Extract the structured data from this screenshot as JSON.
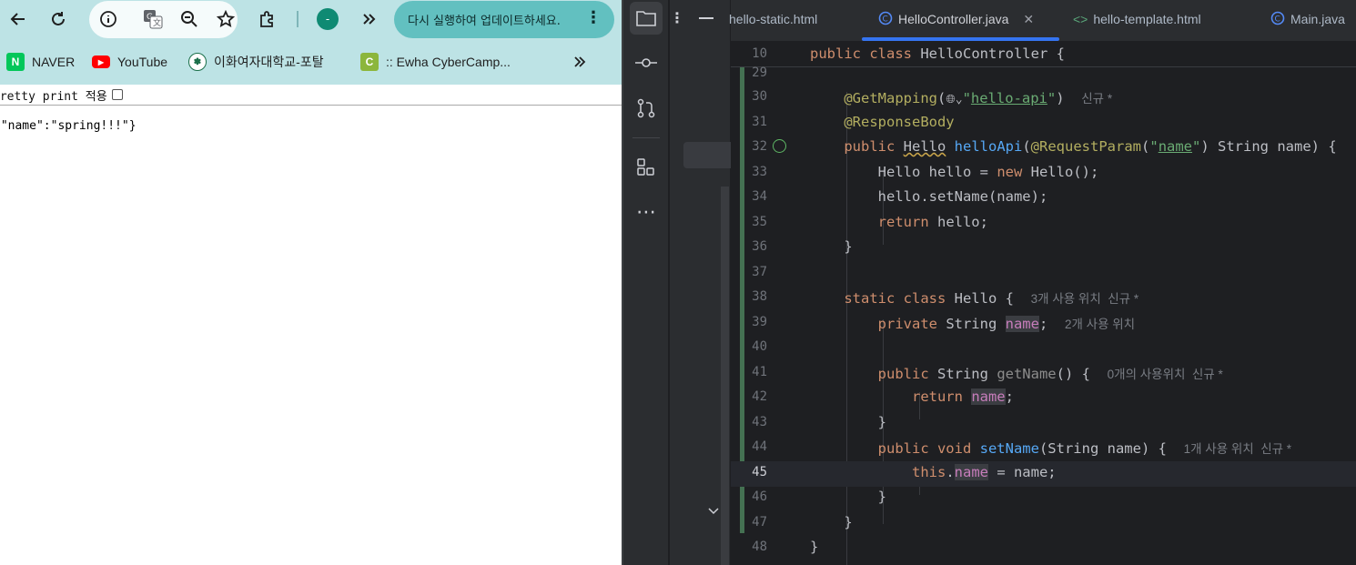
{
  "browser": {
    "toolbar": {
      "back_icon": "arrow-left-icon",
      "reload_icon": "reload-icon",
      "profile_initial": "-",
      "update_label": "다시 실행하여 업데이트하세요."
    },
    "bookmarks": [
      {
        "label": "NAVER",
        "icon": "naver-logo",
        "color": "#03c75a"
      },
      {
        "label": "YouTube",
        "icon": "youtube-logo",
        "color": "#ff0000"
      },
      {
        "label": "이화여자대학교-포탈",
        "icon": "ewha-logo",
        "color": "#1b6f4a"
      },
      {
        "label": ":: Ewha CyberCamp...",
        "icon": "cybercamp-logo",
        "color": "#8cb63c"
      }
    ],
    "page": {
      "pretty_print_label": "Pretty print 적용",
      "json_output": "{\"name\":\"spring!!!\"}"
    }
  },
  "ide": {
    "tabs": [
      {
        "label": "hello-static.html",
        "icon": "html-file-icon"
      },
      {
        "label": "HelloController.java",
        "icon": "java-class-icon",
        "active": true
      },
      {
        "label": "hello-template.html",
        "icon": "html-file-icon"
      },
      {
        "label": "Main.java",
        "icon": "java-class-icon"
      }
    ],
    "sticky_line": {
      "num": "10",
      "code": "public class HelloController {"
    },
    "lines": [
      {
        "num": "29",
        "code": ""
      },
      {
        "num": "30",
        "code": "@GetMapping(\"hello-api\")",
        "hint": "신규 *"
      },
      {
        "num": "31",
        "code": "@ResponseBody"
      },
      {
        "num": "32",
        "code": "public Hello helloApi(@RequestParam(\"name\") String name) {"
      },
      {
        "num": "33",
        "code": "Hello hello = new Hello();"
      },
      {
        "num": "34",
        "code": "hello.setName(name);"
      },
      {
        "num": "35",
        "code": "return hello;"
      },
      {
        "num": "36",
        "code": "}"
      },
      {
        "num": "37",
        "code": ""
      },
      {
        "num": "38",
        "code": "static class Hello {",
        "hint": "3개 사용 위치  신규 *"
      },
      {
        "num": "39",
        "code": "private String name;",
        "hint": "2개 사용 위치"
      },
      {
        "num": "40",
        "code": ""
      },
      {
        "num": "41",
        "code": "public String getName() {",
        "hint": "0개의 사용위치  신규 *"
      },
      {
        "num": "42",
        "code": "return name;"
      },
      {
        "num": "43",
        "code": "}"
      },
      {
        "num": "44",
        "code": "public void setName(String name) {",
        "hint": "1개 사용 위치  신규 *"
      },
      {
        "num": "45",
        "code": "this.name = name;"
      },
      {
        "num": "46",
        "code": "}"
      },
      {
        "num": "47",
        "code": "}"
      },
      {
        "num": "48",
        "code": "}"
      }
    ],
    "caret_line": "45"
  }
}
